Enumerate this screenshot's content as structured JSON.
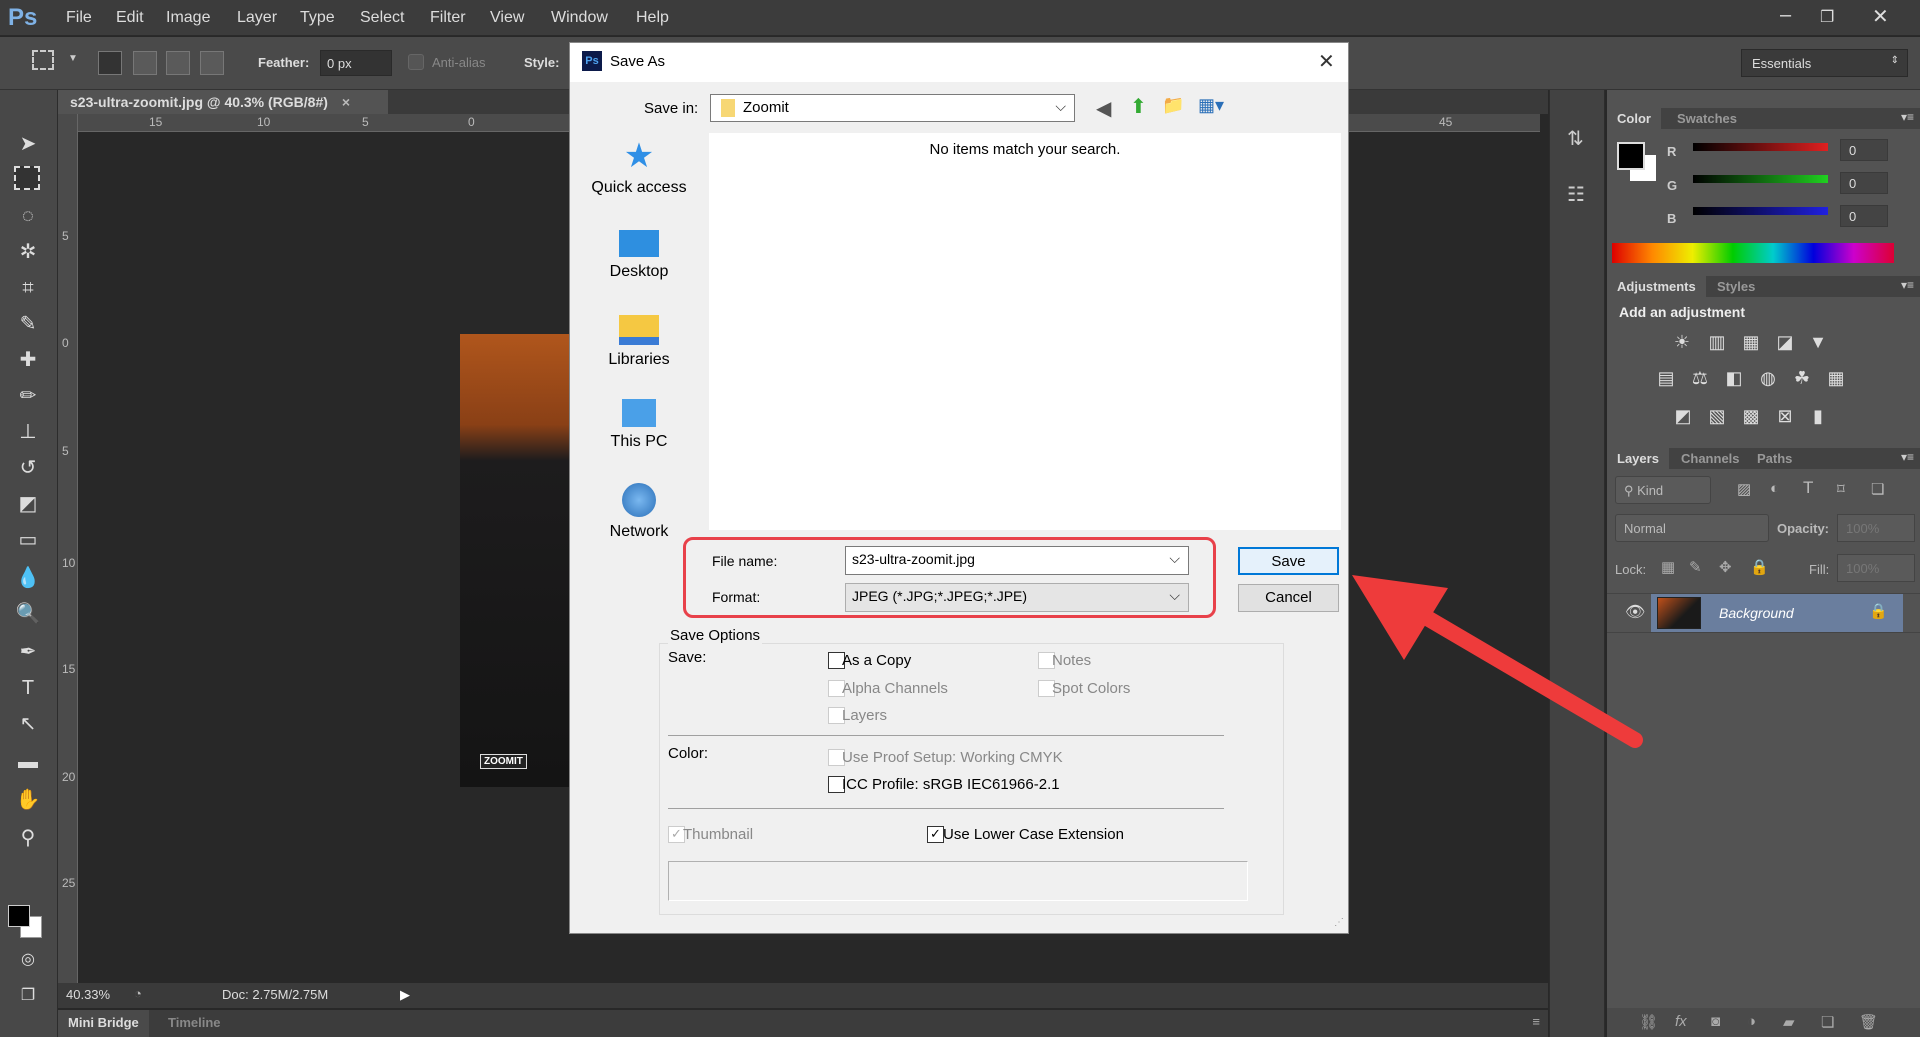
{
  "app": {
    "logo": "Ps",
    "menu": [
      "File",
      "Edit",
      "Image",
      "Layer",
      "Type",
      "Select",
      "Filter",
      "View",
      "Window",
      "Help"
    ],
    "window_controls": [
      "–",
      "❐",
      "✕"
    ]
  },
  "options_bar": {
    "feather_label": "Feather:",
    "feather_value": "0 px",
    "antialias_label": "Anti-alias",
    "style_label": "Style:",
    "workspace": "Essentials"
  },
  "document": {
    "tab_title": "s23-ultra-zoomit.jpg @ 40.3% (RGB/8#)",
    "tab_close": "×",
    "ruler_top": [
      "15",
      "10",
      "5",
      "0",
      "45"
    ],
    "ruler_left": [
      "5",
      "0",
      "5",
      "10",
      "15",
      "20",
      "25"
    ],
    "zoom": "40.33%",
    "doc_info": "Doc: 2.75M/2.75M",
    "watermark": "ZOOMIT"
  },
  "bottom_tabs": [
    "Mini Bridge",
    "Timeline"
  ],
  "color_panel": {
    "tabs": [
      "Color",
      "Swatches"
    ],
    "channels": [
      {
        "label": "R",
        "value": "0",
        "color": "#e02020"
      },
      {
        "label": "G",
        "value": "0",
        "color": "#20d020"
      },
      {
        "label": "B",
        "value": "0",
        "color": "#2020e0"
      }
    ]
  },
  "adjustments_panel": {
    "tabs": [
      "Adjustments",
      "Styles"
    ],
    "heading": "Add an adjustment"
  },
  "layers_panel": {
    "tabs": [
      "Layers",
      "Channels",
      "Paths"
    ],
    "filter_kind": "Kind",
    "blend_mode": "Normal",
    "opacity_label": "Opacity:",
    "opacity_value": "100%",
    "lock_label": "Lock:",
    "fill_label": "Fill:",
    "fill_value": "100%",
    "layers": [
      {
        "name": "Background",
        "visible": true,
        "locked": true
      }
    ]
  },
  "dialog": {
    "title": "Save As",
    "close": "✕",
    "save_in_label": "Save in:",
    "save_in_value": "Zoomit",
    "empty_message": "No items match your search.",
    "places": [
      "Quick access",
      "Desktop",
      "Libraries",
      "This PC",
      "Network"
    ],
    "file_name_label": "File name:",
    "file_name_value": "s23-ultra-zoomit.jpg",
    "format_label": "Format:",
    "format_value": "JPEG (*.JPG;*.JPEG;*.JPE)",
    "save_button": "Save",
    "cancel_button": "Cancel",
    "save_options_title": "Save Options",
    "save_label": "Save:",
    "color_label": "Color:",
    "options": {
      "as_a_copy": {
        "label": "As a Copy",
        "checked": false,
        "enabled": true
      },
      "notes": {
        "label": "Notes",
        "checked": false,
        "enabled": false
      },
      "alpha_channels": {
        "label": "Alpha Channels",
        "checked": false,
        "enabled": false
      },
      "spot_colors": {
        "label": "Spot Colors",
        "checked": false,
        "enabled": false
      },
      "layers": {
        "label": "Layers",
        "checked": false,
        "enabled": false
      },
      "use_proof_setup": {
        "label": "Use Proof Setup:  Working CMYK",
        "checked": false,
        "enabled": false
      },
      "icc_profile": {
        "label": "ICC Profile:  sRGB IEC61966-2.1",
        "checked": false,
        "enabled": true
      },
      "thumbnail": {
        "label": "Thumbnail",
        "checked": true,
        "enabled": false
      },
      "lower_case_ext": {
        "label": "Use Lower Case Extension",
        "checked": true,
        "enabled": true
      }
    }
  },
  "annotation": {
    "highlight_color": "#e8414a",
    "arrow_color": "#ee3b3b"
  }
}
